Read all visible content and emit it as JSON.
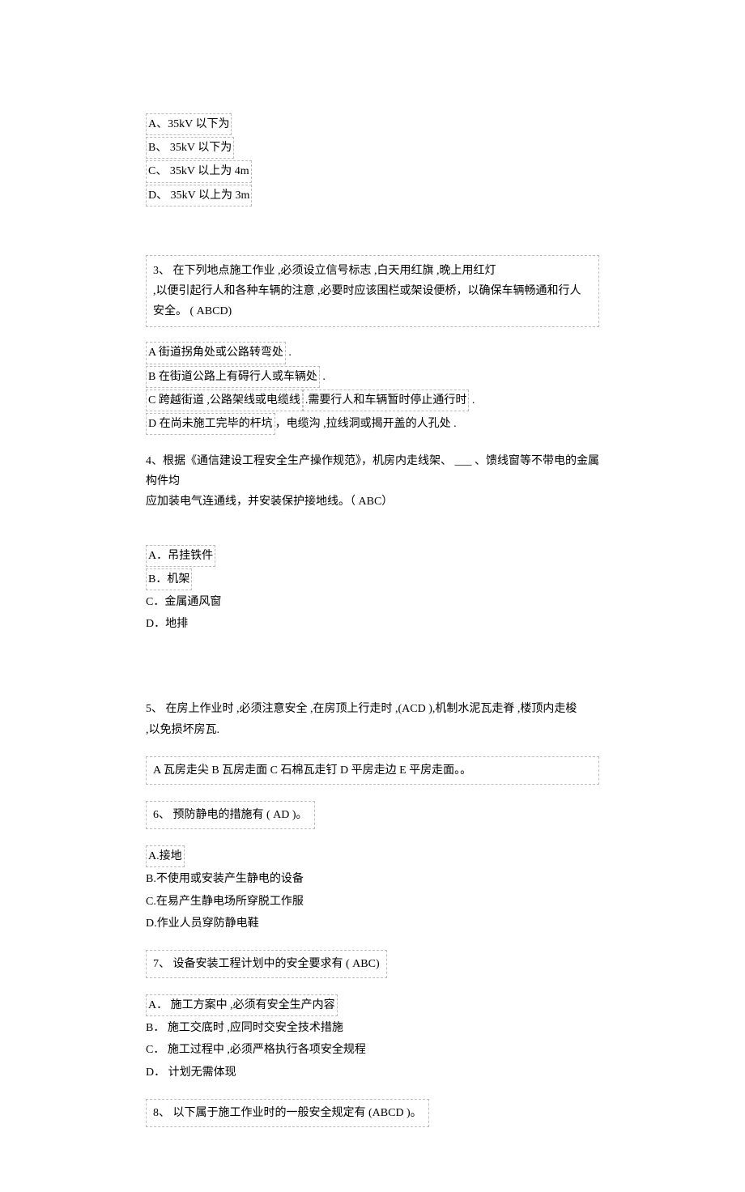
{
  "q2_options": {
    "a": "A、35kV 以下为",
    "b": "B、 35kV 以下为",
    "c": "C、 35kV 以上为 4m",
    "d": "D、 35kV 以上为 3m"
  },
  "q3": {
    "stem_line1": "3、 在下列地点施工作业 ,必须设立信号标志 ,白天用红旗 ,晚上用红灯",
    "stem_line2": ",以便引起行人和各种车辆的注意 ,必要时应该围栏或架设便桥，以确保车辆畅通和行人安全。 ( ABCD)",
    "a": "A 街道拐角处或公路转弯处",
    "b": "B 在街道公路上有碍行人或车辆处",
    "c_pre": "C 跨越街道 ,公路架线或电缆线",
    "c_post": ".需要行人和车辆暂时停止通行时",
    "d_pre": "D 在尚未施工完毕的杆坑",
    "d_post": "，电缆沟 ,拉线洞或揭开盖的人孔处   .",
    "dot": "  ."
  },
  "q4": {
    "stem_line1": "4、根据《通信建设工程安全生产操作规范》，机房内走线架、       ___  、馈线窗等不带电的金属构件均",
    "stem_line2": "应加装电气连通线，并安装保护接地线。（    ABC）",
    "a": "A．吊挂铁件",
    "b": "B．机架",
    "c": "C．金属通风窗",
    "d": "D．地排"
  },
  "q5": {
    "stem_line1": "5、 在房上作业时 ,必须注意安全 ,在房顶上行走时 ,(ACD ),机制水泥瓦走脊 ,楼顶内走梭",
    "stem_line2": ",以免损坏房瓦.",
    "opts": "A 瓦房走尖   B 瓦房走面    C 石棉瓦走钉   D 平房走边   E 平房走面。。"
  },
  "q6": {
    "stem": "6、 预防静电的措施有  ( AD )。",
    "a": "A.接地",
    "b": "B.不使用或安装产生静电的设备",
    "c": "C.在易产生静电场所穿脱工作服",
    "d": "D.作业人员穿防静电鞋"
  },
  "q7": {
    "stem": "7、 设备安装工程计划中的安全要求有     ( ABC)",
    "a": "A．  施工方案中 ,必须有安全生产内容",
    "b": "B．  施工交底时 ,应同时交安全技术措施",
    "c": "C．  施工过程中 ,必须严格执行各项安全规程",
    "d": "D．  计划无需体现"
  },
  "q8": {
    "stem": "8、 以下属于施工作业时的一般安全规定有     (ABCD )。"
  }
}
